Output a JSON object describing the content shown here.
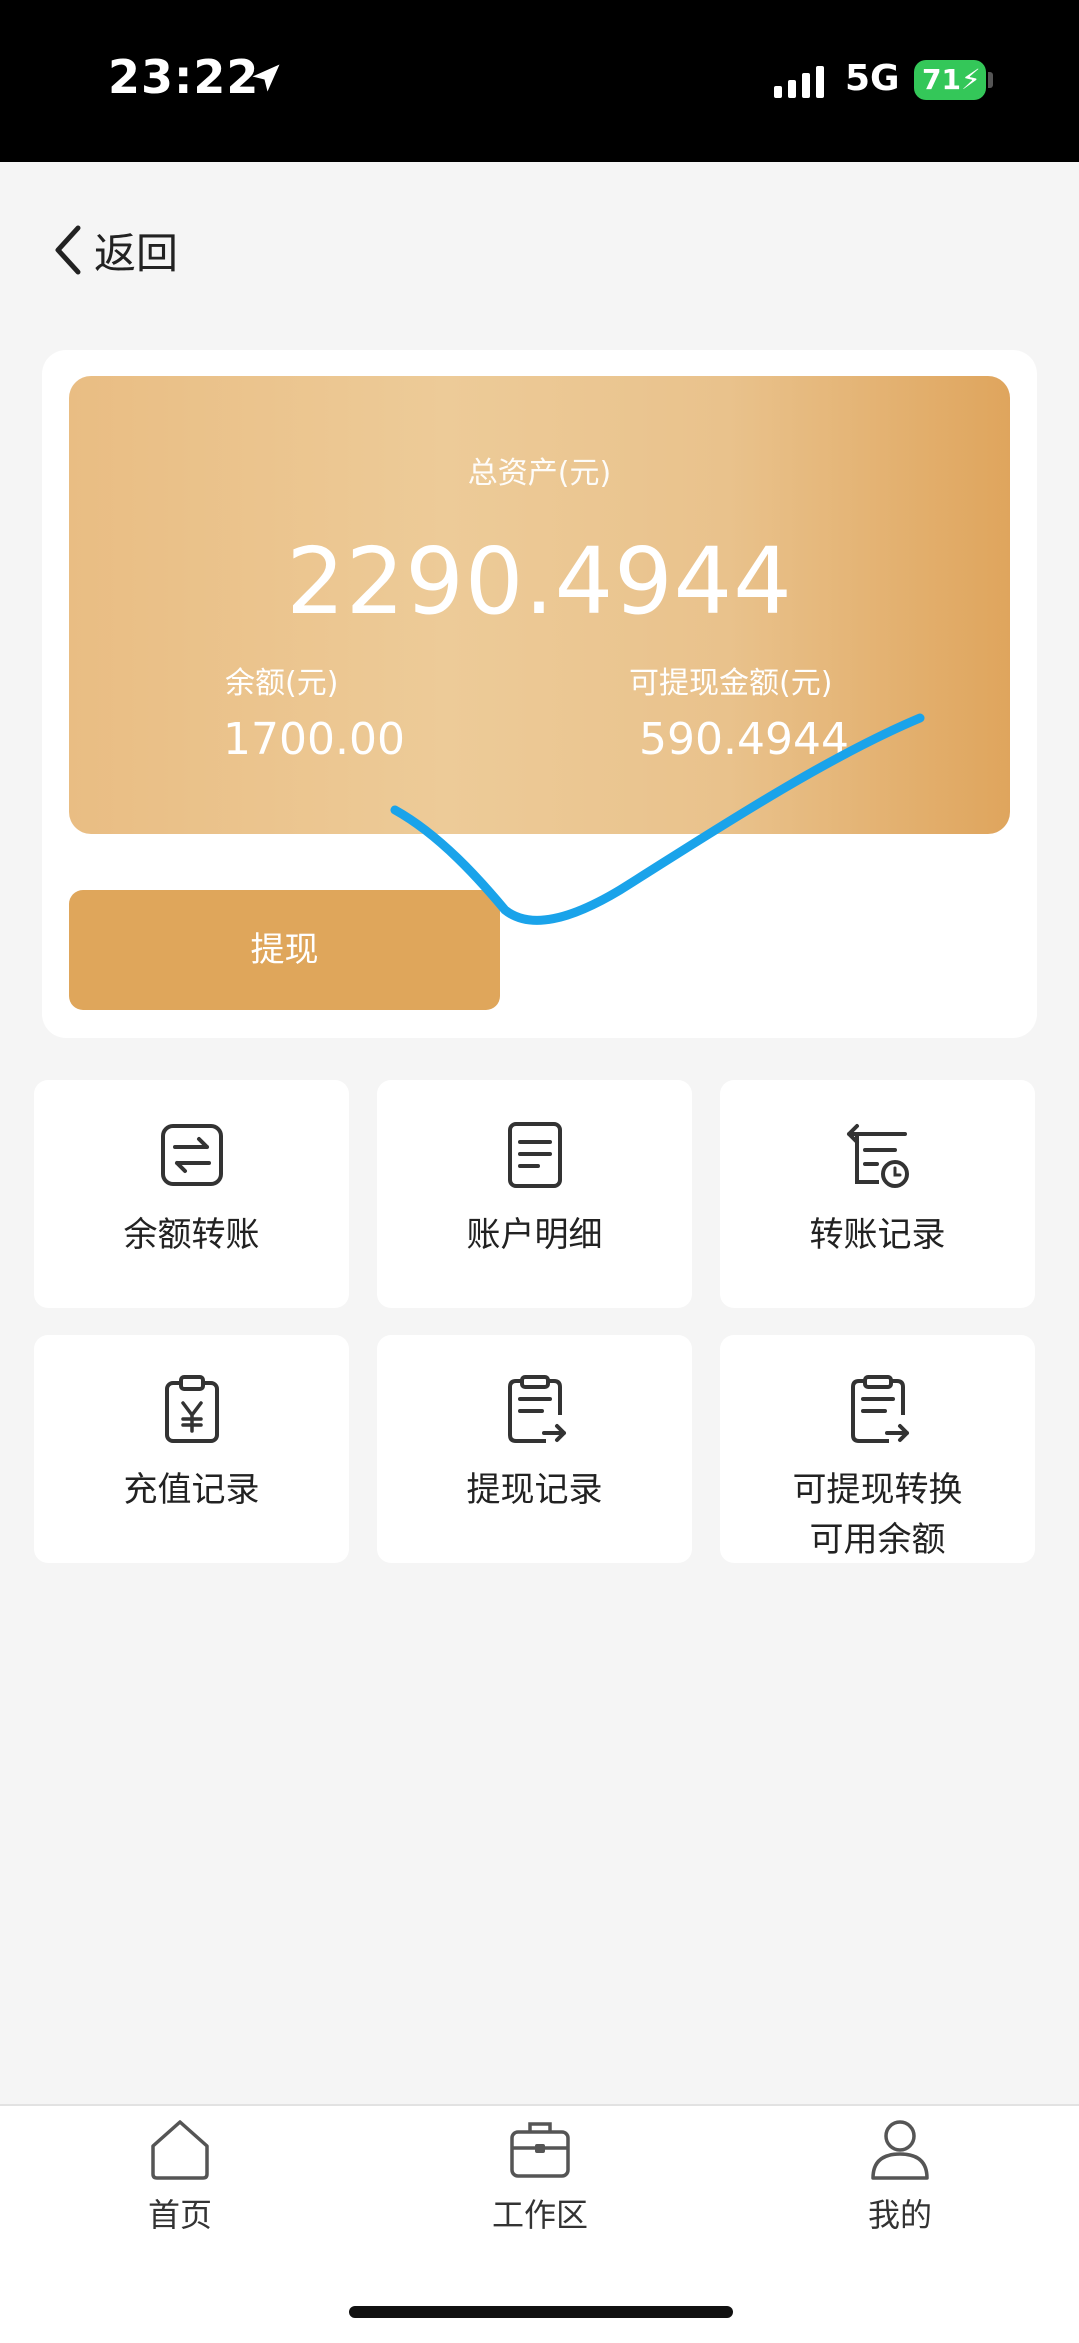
{
  "status_bar": {
    "time": "23:22",
    "network": "5G",
    "battery": "71"
  },
  "nav": {
    "back_label": "返回"
  },
  "assets": {
    "total_label": "总资产(元)",
    "total_value": "2290.4944",
    "balance_label": "余额(元)",
    "balance_value": "1700.00",
    "withdrawable_label": "可提现金额(元)",
    "withdrawable_value": "590.4944"
  },
  "actions": {
    "withdraw_label": "提现"
  },
  "menu": [
    {
      "label": "余额转账",
      "icon": "transfer-icon"
    },
    {
      "label": "账户明细",
      "icon": "document-icon"
    },
    {
      "label": "转账记录",
      "icon": "transfer-history-icon"
    },
    {
      "label": "充值记录",
      "icon": "recharge-clipboard-icon"
    },
    {
      "label": "提现记录",
      "icon": "withdraw-record-icon"
    },
    {
      "label": "可提现转换\n可用余额",
      "icon": "convert-record-icon"
    }
  ],
  "tabbar": [
    {
      "label": "首页",
      "icon": "home-icon"
    },
    {
      "label": "工作区",
      "icon": "briefcase-icon"
    },
    {
      "label": "我的",
      "icon": "user-icon"
    }
  ],
  "colors": {
    "card_gold": "#e9bd83",
    "button_gold": "#dfa65b",
    "battery_green": "#34c759",
    "scribble_blue": "#1aa3ea"
  }
}
